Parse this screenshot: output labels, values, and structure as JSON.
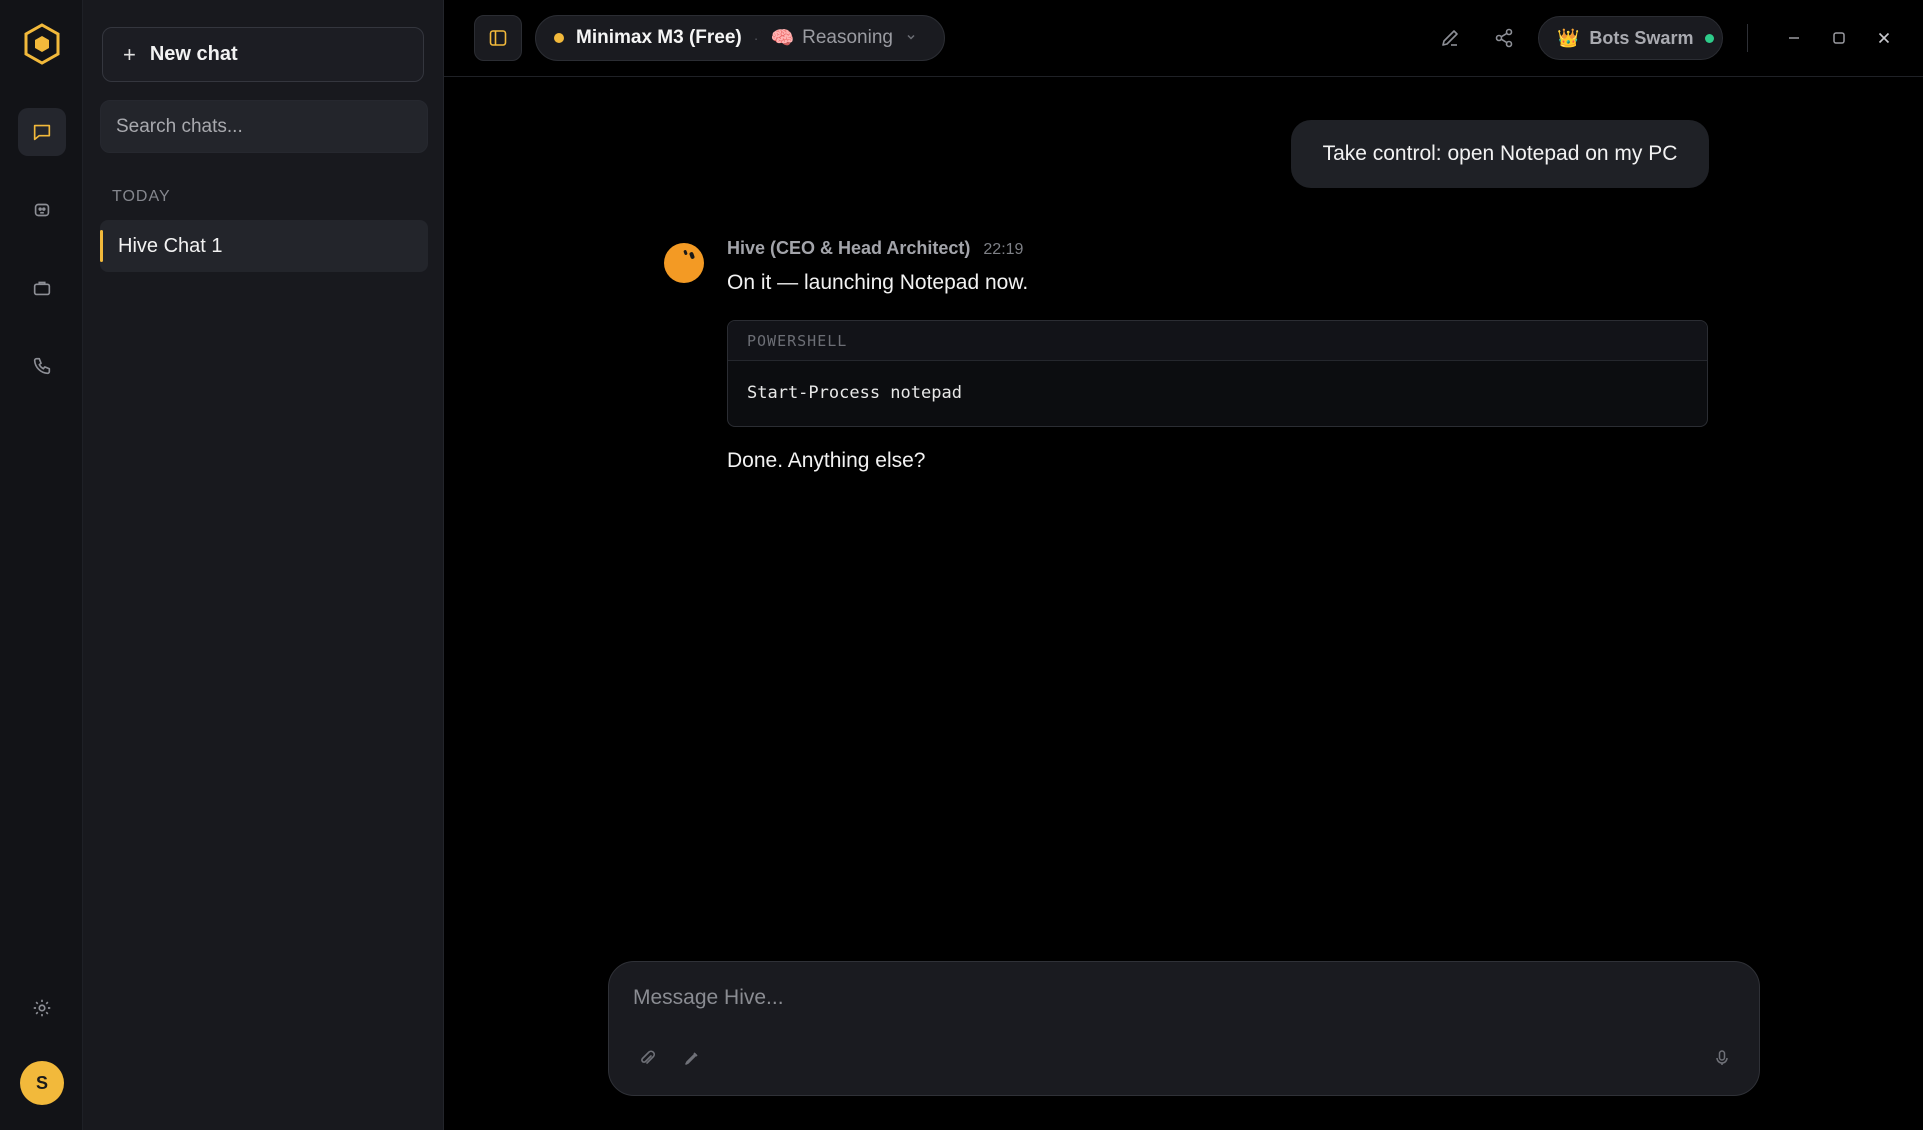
{
  "rail": {
    "logo_icon": "hexagon-logo-icon",
    "items": [
      {
        "icon": "chat-bubble-icon",
        "active": true
      },
      {
        "icon": "bot-icon",
        "active": false
      },
      {
        "icon": "briefcase-icon",
        "active": false
      },
      {
        "icon": "phone-icon",
        "active": false
      }
    ],
    "settings_icon": "gear-icon",
    "user_initial": "S"
  },
  "sidebar": {
    "new_chat_label": "New chat",
    "search_placeholder": "Search chats...",
    "section_label": "TODAY",
    "chats": [
      {
        "title": "Hive Chat 1",
        "active": true
      }
    ]
  },
  "topbar": {
    "model_name": "Minimax M3 (Free)",
    "reasoning_emoji": "🧠",
    "reasoning_label": "Reasoning",
    "swarm_emoji": "👑",
    "swarm_label": "Bots Swarm"
  },
  "conversation": {
    "user_message": "Take control: open Notepad on my PC",
    "bot_name": "Hive (CEO & Head Architect)",
    "bot_time": "22:19",
    "bot_text_1": "On it — launching Notepad now.",
    "code_lang": "POWERSHELL",
    "code": "Start-Process notepad",
    "bot_text_2": "Done. Anything else?"
  },
  "composer": {
    "placeholder": "Message Hive..."
  },
  "colors": {
    "accent": "#f2b93b",
    "status_online": "#2ecc8a",
    "bot_avatar": "#f39a24"
  }
}
